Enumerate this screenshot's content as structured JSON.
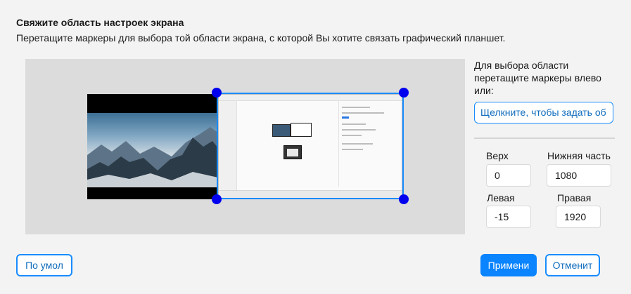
{
  "header": {
    "title": "Свяжите область настроек экрана",
    "subtitle": "Перетащите маркеры для выбора той области экрана, с которой Вы хотите связать графический планшет."
  },
  "sidebar": {
    "hint": "Для выбора области перетащите маркеры влево или:",
    "set_button_label": "Щелкните, чтобы задать об"
  },
  "fields": {
    "top": {
      "label": "Верх",
      "value": "0"
    },
    "bottom": {
      "label": "Нижняя часть",
      "value": "1080"
    },
    "left": {
      "label": "Левая",
      "value": "-15"
    },
    "right": {
      "label": "Правая",
      "value": "1920"
    }
  },
  "footer": {
    "default_button": "По умол",
    "apply_button": "Примени",
    "cancel_button": "Отменит"
  },
  "colors": {
    "accent": "#1a8cff",
    "handle": "#0000ee",
    "primary_button": "#0a84ff"
  }
}
